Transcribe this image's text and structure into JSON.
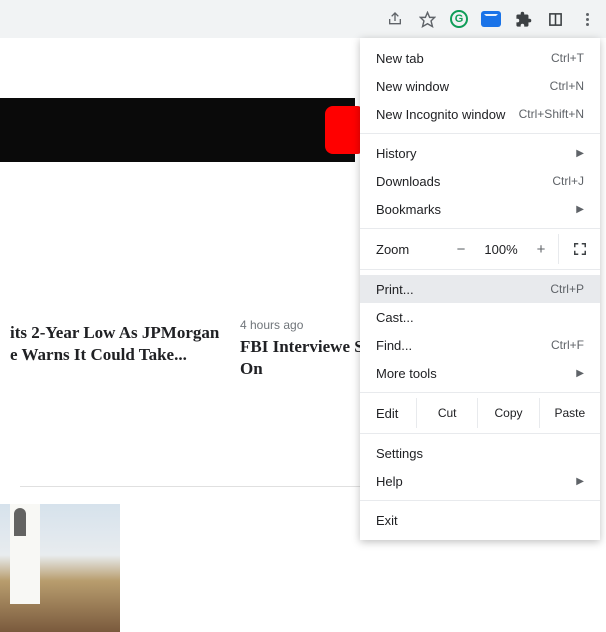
{
  "menu": {
    "new_tab": "New tab",
    "new_tab_sc": "Ctrl+T",
    "new_window": "New window",
    "new_window_sc": "Ctrl+N",
    "incognito": "New Incognito window",
    "incognito_sc": "Ctrl+Shift+N",
    "history": "History",
    "downloads": "Downloads",
    "downloads_sc": "Ctrl+J",
    "bookmarks": "Bookmarks",
    "zoom": "Zoom",
    "zoom_minus": "−",
    "zoom_val": "100%",
    "zoom_plus": "+",
    "print": "Print...",
    "print_sc": "Ctrl+P",
    "cast": "Cast...",
    "find": "Find...",
    "find_sc": "Ctrl+F",
    "more_tools": "More tools",
    "edit": "Edit",
    "cut": "Cut",
    "copy": "Copy",
    "paste": "Paste",
    "settings": "Settings",
    "help": "Help",
    "exit": "Exit"
  },
  "headlines": [
    {
      "ts": "",
      "title": "its 2-Year Low As JPMorgan e Warns It Could Take..."
    },
    {
      "ts": "4 hours ago",
      "title": "FBI Interviewe Signed Off On"
    }
  ]
}
